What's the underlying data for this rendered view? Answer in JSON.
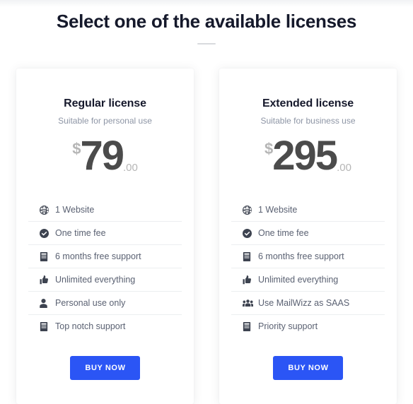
{
  "page": {
    "heading": "Select one of the available licenses"
  },
  "cards": [
    {
      "title": "Regular license",
      "subtitle": "Suitable for personal use",
      "currency": "$",
      "amount": "79",
      "cents": ".00",
      "features": [
        {
          "icon": "globe-icon",
          "label": "1 Website"
        },
        {
          "icon": "check-circle-icon",
          "label": "One time fee"
        },
        {
          "icon": "book-icon",
          "label": "6 months free support"
        },
        {
          "icon": "thumbs-up-icon",
          "label": "Unlimited everything"
        },
        {
          "icon": "user-icon",
          "label": "Personal use only"
        },
        {
          "icon": "book-icon",
          "label": "Top notch support"
        }
      ],
      "buy_label": "BUY NOW"
    },
    {
      "title": "Extended license",
      "subtitle": "Suitable for business use",
      "currency": "$",
      "amount": "295",
      "cents": ".00",
      "features": [
        {
          "icon": "globe-icon",
          "label": "1 Website"
        },
        {
          "icon": "check-circle-icon",
          "label": "One time fee"
        },
        {
          "icon": "book-icon",
          "label": "6 months free support"
        },
        {
          "icon": "thumbs-up-icon",
          "label": "Unlimited everything"
        },
        {
          "icon": "users-icon",
          "label": "Use MailWizz as SAAS"
        },
        {
          "icon": "book-icon",
          "label": "Priority support"
        }
      ],
      "buy_label": "BUY NOW"
    }
  ],
  "colors": {
    "accent": "#2b55f5",
    "heading": "#15192b",
    "subtitle": "#8d95a5",
    "price": "#4b4b4b",
    "price_muted": "#b6b6b6",
    "feature_text": "#5a6172",
    "divider": "#eceef0",
    "card_bg": "#ffffff",
    "page_bg": "#ffffff"
  }
}
